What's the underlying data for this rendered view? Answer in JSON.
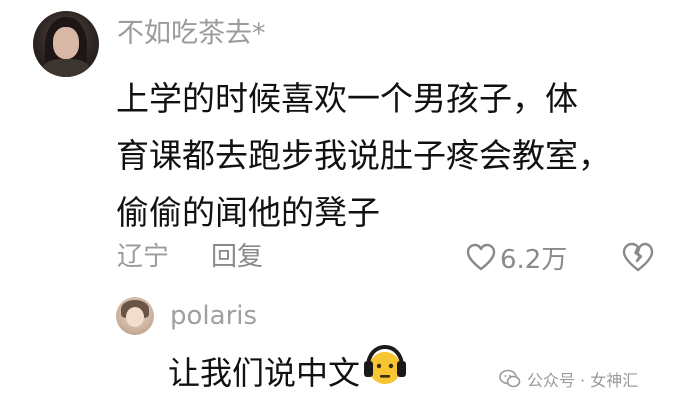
{
  "comment": {
    "username": "不如吃茶去*",
    "text_lines": [
      "上学的时候喜欢一个男孩子，体",
      "育课都去跑步我说肚子疼会教室，",
      "偷偷的闻他的凳子"
    ],
    "location": "辽宁",
    "reply_label": "回复",
    "like_count": "6.2万"
  },
  "reply": {
    "username": "polaris",
    "text": "让我们说中文"
  },
  "watermark": {
    "text": "公众号 · 女神汇"
  }
}
